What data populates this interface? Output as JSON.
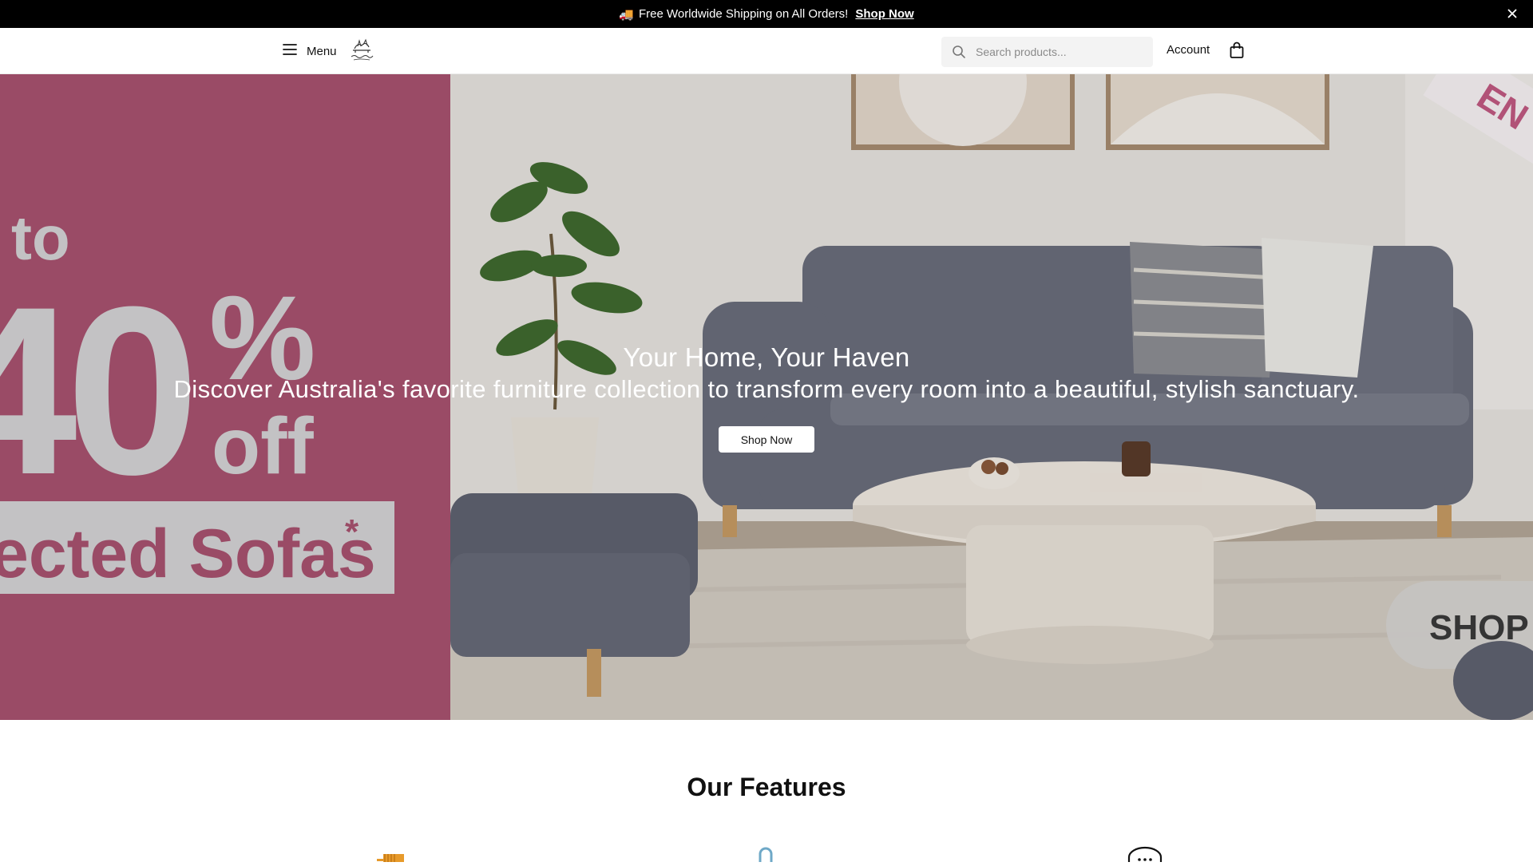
{
  "announcement": {
    "icon": "delivery-truck-emoji",
    "text": "Free Worldwide Shipping on All Orders!",
    "link_label": "Shop Now",
    "close_icon": "close-icon"
  },
  "header": {
    "menu_label": "Menu",
    "search_placeholder": "Search products...",
    "account_label": "Account",
    "icons": [
      "hamburger-icon",
      "logo",
      "search-icon",
      "shopping-bag-icon"
    ]
  },
  "hero": {
    "title": "Your Home, Your Haven",
    "subtitle": "Discover Australia's favorite furniture collection to transform every room into a beautiful, stylish sanctuary.",
    "button_label": "Shop Now",
    "promo": {
      "line1": "to",
      "big": "40",
      "percent": "%",
      "off": "off",
      "sofas": "ected Sofas",
      "asterisk": "*",
      "corner": "EN",
      "shop": "SHOP"
    },
    "colors": {
      "promo_pink": "#a8526f",
      "sofa": "#6b6e7c",
      "wall": "#e6e2de"
    }
  },
  "features": {
    "title": "Our Features"
  }
}
